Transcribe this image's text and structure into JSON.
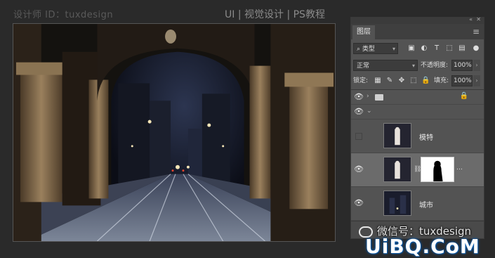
{
  "watermarks": {
    "designer_id": "设计师 ID：tuxdesign",
    "series": "UI | 视觉设计 | PS教程",
    "wechat": "微信号：tuxdesign",
    "site": "UiBQ.CoM"
  },
  "panel": {
    "tab": "图层",
    "filter_kind": "类型",
    "blend_mode": "正常",
    "opacity_label": "不透明度:",
    "opacity_value": "100%",
    "lock_label": "锁定:",
    "fill_label": "填充:",
    "fill_value": "100%",
    "layers": [
      {
        "name": "",
        "type": "group",
        "visible": true,
        "locked": true
      },
      {
        "name": "",
        "type": "group-open",
        "visible": true
      },
      {
        "name": "模特",
        "type": "image",
        "visible": false
      },
      {
        "name": "",
        "type": "image-mask",
        "visible": true,
        "selected": true
      },
      {
        "name": "城市",
        "type": "image",
        "visible": true
      }
    ]
  },
  "colors": {
    "panel_bg": "#535353",
    "selected_layer": "#6b6b6b",
    "app_bg": "#2a2a2a"
  }
}
